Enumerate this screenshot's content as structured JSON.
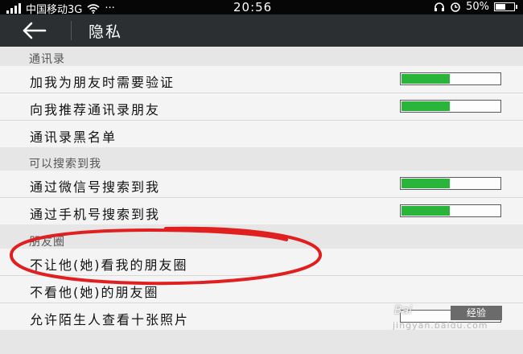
{
  "status_bar": {
    "carrier": "中国移动3G",
    "time": "20:56",
    "battery": "50%"
  },
  "title_bar": {
    "title": "隐私"
  },
  "sections": [
    {
      "label": "通讯录",
      "rows": [
        {
          "label": "加我为朋友时需要验证",
          "toggle": "on"
        },
        {
          "label": "向我推荐通讯录朋友",
          "toggle": "on"
        },
        {
          "label": "通讯录黑名单",
          "toggle": null
        }
      ]
    },
    {
      "label": "可以搜索到我",
      "rows": [
        {
          "label": "通过微信号搜索到我",
          "toggle": "on"
        },
        {
          "label": "通过手机号搜索到我",
          "toggle": "on"
        }
      ]
    },
    {
      "label": "朋友圈",
      "rows": [
        {
          "label": "不让他(她)看我的朋友圈",
          "toggle": null
        },
        {
          "label": "不看他(她)的朋友圈",
          "toggle": null
        },
        {
          "label": "允许陌生人查看十张照片",
          "toggle": "off"
        }
      ]
    }
  ],
  "watermark": {
    "brand": "Bai",
    "badge": "经验",
    "url": "jingyan.baidu.com"
  },
  "colors": {
    "toggle_on": "#28b53a",
    "title_bar": "#2b2f31",
    "annotation": "#e02020"
  }
}
